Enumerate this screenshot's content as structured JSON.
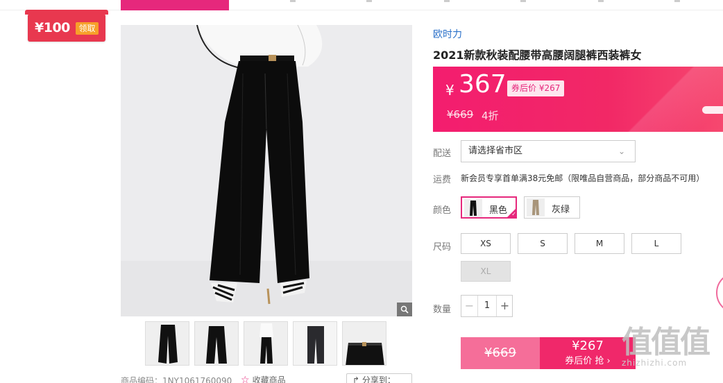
{
  "coupon": {
    "amount": "¥100",
    "action": "领取"
  },
  "product": {
    "brand": "欧时力",
    "title": "2021新款秋装配腰带高腰阔腿裤西装裤女",
    "sku_label": "商品编码：1NY1061760090",
    "favorite_label": "收藏商品",
    "share_label": "分享到："
  },
  "price": {
    "currency": "¥",
    "current": "367",
    "after_coupon": "券后价 ¥267",
    "original": "¥669",
    "discount": "4折"
  },
  "delivery": {
    "label": "配送",
    "placeholder": "请选择省市区"
  },
  "shipping": {
    "label": "运费",
    "text": "新会员专享首单满38元免邮（限唯品自营商品，部分商品不可用）"
  },
  "colors": {
    "label": "颜色",
    "options": [
      {
        "name": "黑色",
        "selected": true
      },
      {
        "name": "灰绿",
        "selected": false
      }
    ]
  },
  "sizes": {
    "label": "尺码",
    "options": [
      {
        "name": "XS",
        "available": true
      },
      {
        "name": "S",
        "available": true
      },
      {
        "name": "M",
        "available": true
      },
      {
        "name": "L",
        "available": true
      },
      {
        "name": "XL",
        "available": false
      }
    ]
  },
  "quantity": {
    "label": "数量",
    "value": "1",
    "minus": "−",
    "plus": "+"
  },
  "buy": {
    "original": "¥669",
    "price": "¥267",
    "action": "券后价 抢 ›"
  },
  "watermark": {
    "logo": "值值值",
    "url": "zhizhizhi.com"
  },
  "colors_theme": {
    "accent": "#e6287c",
    "price_bg": "#f31d6f",
    "link": "#2a70c9"
  }
}
